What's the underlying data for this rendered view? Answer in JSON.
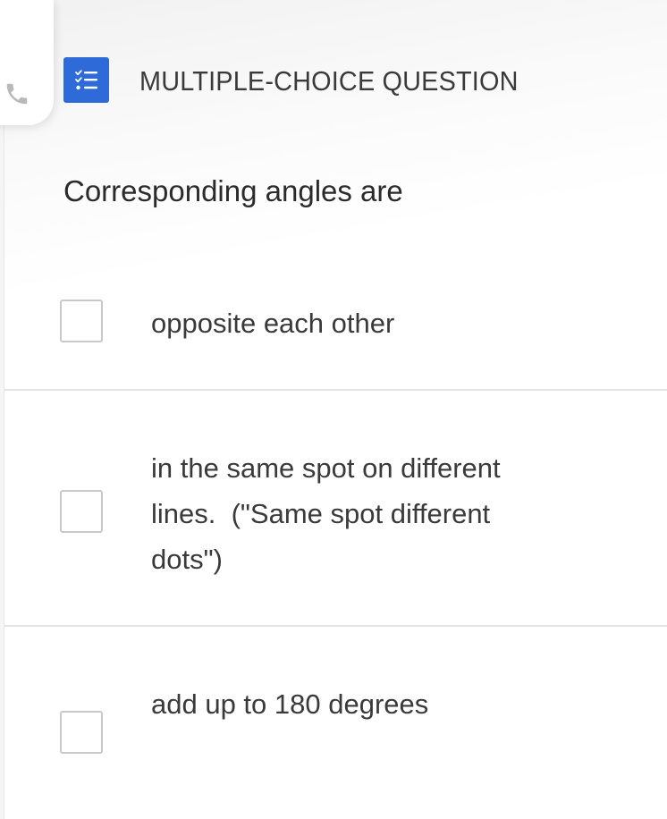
{
  "header": {
    "phone_icon": "phone-icon",
    "type_icon": "checklist-icon",
    "type_icon_color": "#2f6bd8",
    "question_type": "MULTIPLE-CHOICE QUESTION"
  },
  "question": {
    "text": "Corresponding angles are"
  },
  "options": [
    {
      "label": "opposite each other",
      "checked": false
    },
    {
      "label": "in the same spot on different lines.  (\"Same spot different dots\")",
      "checked": false
    },
    {
      "label": "add up to 180 degrees",
      "checked": false
    }
  ]
}
